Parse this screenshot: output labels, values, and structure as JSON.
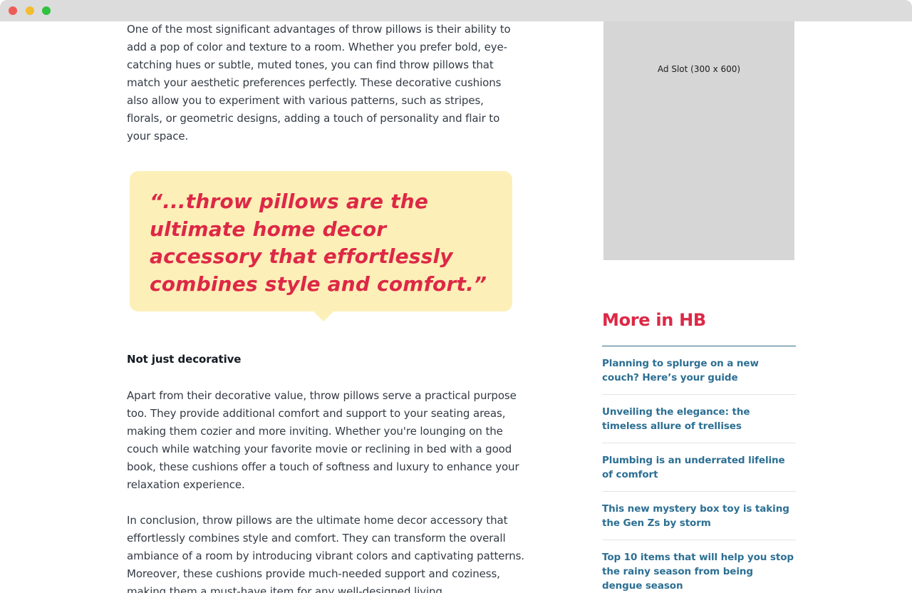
{
  "window": {
    "controls": [
      "close",
      "minimize",
      "zoom"
    ]
  },
  "article": {
    "paragraph_1": "One of the most significant advantages of throw pillows is their ability to add a pop of color and texture to a room. Whether you prefer bold, eye-catching hues or subtle, muted tones, you can find throw pillows that match your aesthetic preferences perfectly. These decorative cushions also allow you to experiment with various patterns, such as stripes, florals, or geometric designs, adding a touch of personality and flair to your space.",
    "pull_quote": "“...throw pillows are the ultimate home decor accessory that effortlessly combines style and comfort.”",
    "subheading": "Not just decorative",
    "paragraph_2": "Apart from their decorative value, throw pillows serve a practical purpose too. They provide additional comfort and support to your seating areas, making them cozier and more inviting. Whether you're lounging on the couch while watching your favorite movie or reclining in bed with a good book, these cushions offer a touch of softness and luxury to enhance your relaxation experience.",
    "paragraph_3": "In conclusion, throw pillows are the ultimate home decor accessory that effortlessly combines style and comfort. They can transform the overall ambiance of a room by introducing vibrant colors and captivating patterns. Moreover, these cushions provide much-needed support and coziness, making them a must-have item for any well-designed living"
  },
  "sidebar": {
    "ad_label": "Ad Slot (300 x 600)",
    "more_title": "More in HB",
    "links": [
      "Planning to splurge on a new couch? Here’s your guide",
      "Unveiling the elegance: the timeless allure of trellises",
      "Plumbing is an underrated lifeline of comfort",
      "This new mystery box toy is taking the Gen Zs by storm",
      "Top 10 items that will help you stop the rainy season from being dengue season"
    ]
  },
  "colors": {
    "accent": "#dd2846",
    "quote_background": "#fcefb8",
    "link": "#2c6f93",
    "rule": "#2e6a86",
    "ad_background": "#d6d6d6"
  }
}
